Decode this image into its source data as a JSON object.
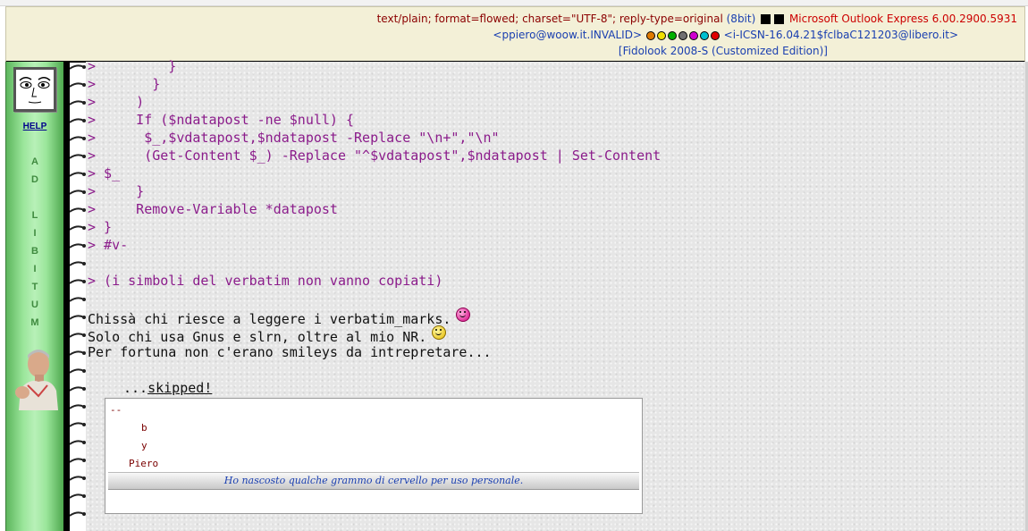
{
  "header": {
    "line1_format": "text/plain; format=flowed; charset=\"UTF-8\"; reply-type=original",
    "line1_bits": "(8bit)",
    "line1_client": "Microsoft Outlook Express 6.00.2900.5931",
    "line2_email": "<ppiero@woow.it.INVALID>",
    "line2_msgid": "<i-ICSN-16.04.21$fclbaC121203@libero.it>",
    "line3_edition": "[Fidolook 2008-S (Customized Edition)]",
    "status_dots": [
      {
        "name": "orange-dot",
        "color": "#e07a00"
      },
      {
        "name": "yellow-dot",
        "color": "#f0e000"
      },
      {
        "name": "green-dot",
        "color": "#00b000"
      },
      {
        "name": "gray-dot",
        "color": "#707070"
      },
      {
        "name": "magenta-dot",
        "color": "#d000d0"
      },
      {
        "name": "cyan-dot",
        "color": "#00c0d0"
      },
      {
        "name": "red-dot",
        "color": "#e00000"
      }
    ]
  },
  "sidebar": {
    "help_label": "HELP",
    "letters": [
      "A",
      "D",
      "",
      "L",
      "I",
      "B",
      "I",
      "T",
      "U",
      "M"
    ]
  },
  "message": {
    "lines": [
      {
        "text": ">         }",
        "style": "q"
      },
      {
        "text": ">       }",
        "style": "q"
      },
      {
        "text": ">     )",
        "style": "q"
      },
      {
        "text": ">     If ($ndatapost -ne $null) {",
        "style": "q"
      },
      {
        "text": ">      $_,$vdatapost,$ndatapost -Replace \"\\n+\",\"\\n\"",
        "style": "q"
      },
      {
        "text": ">      (Get-Content $_) -Replace \"^$vdatapost\",$ndatapost | Set-Content",
        "style": "q"
      },
      {
        "text": "> $_",
        "style": "q"
      },
      {
        "text": ">     }",
        "style": "q"
      },
      {
        "text": ">     Remove-Variable *datapost",
        "style": "q"
      },
      {
        "text": "> }",
        "style": "q"
      },
      {
        "text": "> #v-",
        "style": "q"
      },
      {
        "text": "",
        "style": "q"
      },
      {
        "text": "> (i simboli del verbatim non vanno copiati)",
        "style": "q"
      },
      {
        "text": "",
        "style": "q"
      },
      {
        "text": "Chissà chi riesce a leggere i verbatim_marks.",
        "style": "n",
        "smiley": "pink"
      },
      {
        "text": "Solo chi usa Gnus e slrn, oltre al mio NR.",
        "style": "n",
        "smiley": "yellow"
      },
      {
        "text": "Per fortuna non c'erano smileys da intrepretare...",
        "style": "n"
      }
    ],
    "skipped_prefix": "...",
    "skipped_label": "skipped!"
  },
  "signature": {
    "dashes": "--",
    "line_b": "b",
    "line_y": "y",
    "name": "Piero",
    "tagline": "Ho nascosto qualche grammo di cervello per uso personale."
  }
}
